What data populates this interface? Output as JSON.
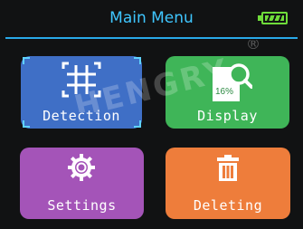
{
  "header": {
    "title": "Main Menu",
    "battery_icon": "battery-full-icon"
  },
  "watermark": {
    "text": "HENGRY",
    "symbol": "®"
  },
  "menu": {
    "items": [
      {
        "label": "Detection",
        "icon": "detection-grid-icon",
        "color": "#3f6fc6",
        "selected": true
      },
      {
        "label": "Display",
        "icon": "image-magnify-icon",
        "color": "#3fb558",
        "icon_text": "16%"
      },
      {
        "label": "Settings",
        "icon": "gear-icon",
        "color": "#a454b8"
      },
      {
        "label": "Deleting",
        "icon": "trash-icon",
        "color": "#ee7d3b"
      }
    ]
  },
  "colors": {
    "title": "#3fc6ff",
    "rule": "#29a9e8",
    "battery": "#6fdc3a",
    "selection": "#5fd2ff",
    "background": "#111213"
  }
}
